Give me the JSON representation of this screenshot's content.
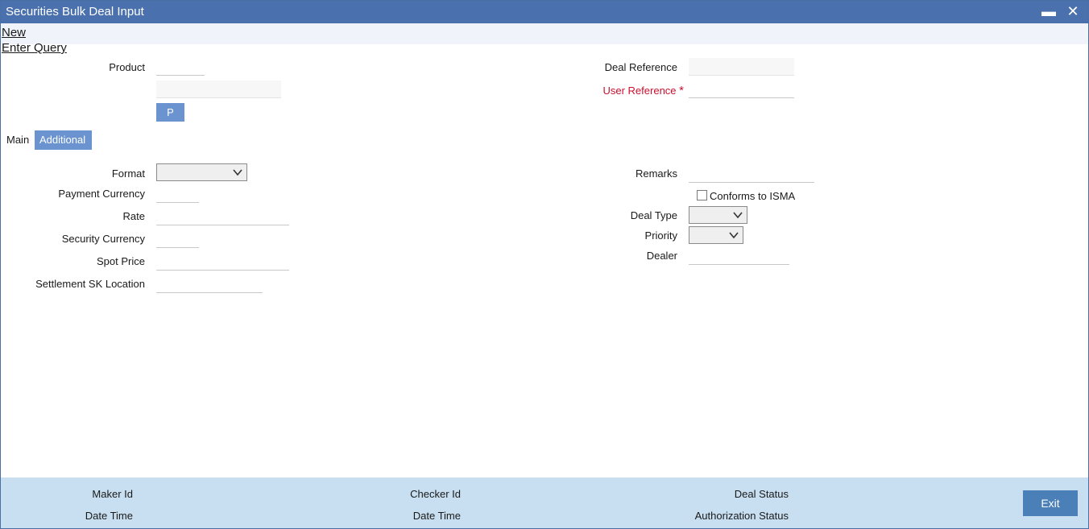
{
  "window": {
    "title": "Securities Bulk Deal Input",
    "minimize_glyph": "▬",
    "close_glyph": "✕"
  },
  "menu": {
    "new_label": "New",
    "enter_query_label": "Enter Query"
  },
  "header": {
    "product_label": "Product",
    "product_value": "",
    "product_desc_value": "",
    "p_button_label": "P",
    "deal_reference_label": "Deal Reference",
    "deal_reference_value": "",
    "user_reference_label": "User Reference",
    "user_reference_required": "*",
    "user_reference_value": ""
  },
  "tabs": [
    {
      "label": "Main",
      "active": false
    },
    {
      "label": "Additional",
      "active": true
    }
  ],
  "form": {
    "format_label": "Format",
    "format_value": "",
    "payment_currency_label": "Payment Currency",
    "payment_currency_value": "",
    "rate_label": "Rate",
    "rate_value": "",
    "security_currency_label": "Security Currency",
    "security_currency_value": "",
    "spot_price_label": "Spot Price",
    "spot_price_value": "",
    "settlement_sk_label": "Settlement SK Location",
    "settlement_sk_value": "",
    "remarks_label": "Remarks",
    "remarks_value": "",
    "isma_label": "Conforms to ISMA",
    "isma_checked": false,
    "deal_type_label": "Deal Type",
    "deal_type_value": "",
    "priority_label": "Priority",
    "priority_value": "",
    "dealer_label": "Dealer",
    "dealer_value": ""
  },
  "footer": {
    "maker_id_label": "Maker Id",
    "maker_date_label": "Date Time",
    "checker_id_label": "Checker Id",
    "checker_date_label": "Date Time",
    "deal_status_label": "Deal Status",
    "auth_status_label": "Authorization Status",
    "exit_label": "Exit"
  },
  "colors": {
    "titlebar": "#4a70ad",
    "accent_button": "#6a93cf",
    "footer_bg": "#c7dff0",
    "exit_button": "#4a7fb8",
    "required": "#c8102e"
  },
  "icons": {
    "minimize": "minimize-icon",
    "close": "close-icon",
    "dropdown": "chevron-down-icon"
  }
}
